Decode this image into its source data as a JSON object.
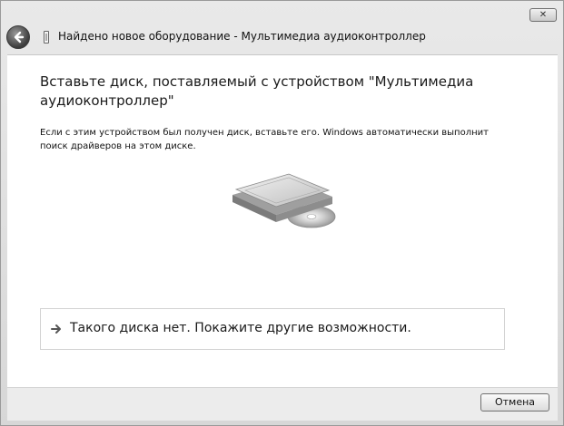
{
  "window": {
    "title": "Найдено новое оборудование - Мультимедиа аудиоконтроллер",
    "close_glyph": "✕"
  },
  "main": {
    "heading": "Вставьте диск, поставляемый с устройством \"Мультимедиа аудиоконтроллер\"",
    "instruction": "Если с этим устройством был получен диск, вставьте его. Windows автоматически выполнит поиск драйверов на этом диске."
  },
  "option": {
    "label": "Такого диска нет. Покажите другие возможности."
  },
  "footer": {
    "cancel_label": "Отмена"
  }
}
